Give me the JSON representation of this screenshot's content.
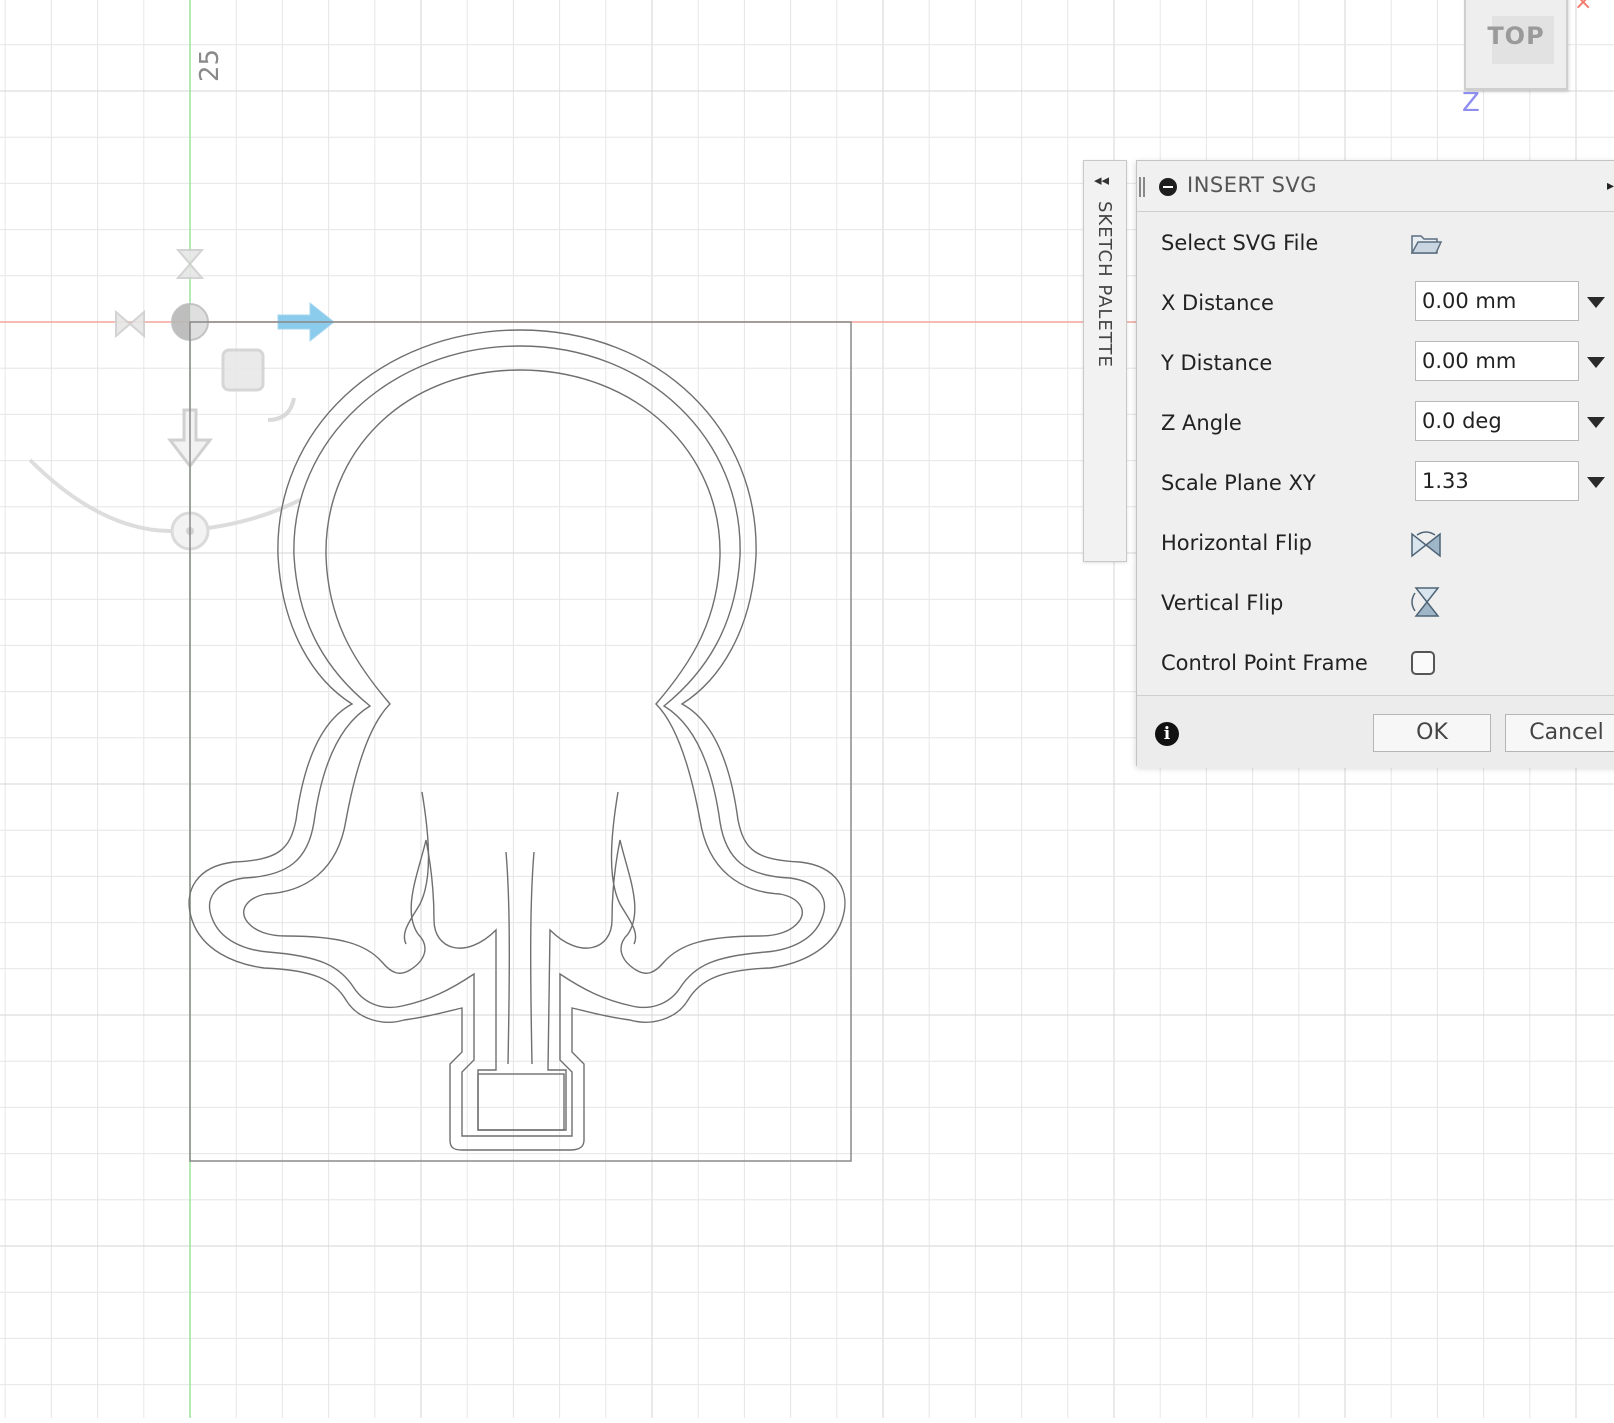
{
  "viewport": {
    "ruler_label": "25",
    "viewcube": {
      "face_label": "TOP",
      "axis_label": "Z",
      "close_symbol": "×"
    }
  },
  "sketch_palette": {
    "label": "SKETCH PALETTE",
    "collapse_symbol": "◂◂"
  },
  "dialog": {
    "title": "INSERT SVG",
    "expand_symbol": "▸",
    "rows": {
      "select_file": {
        "label": "Select SVG File",
        "icon": "folder-open-icon"
      },
      "x_distance": {
        "label": "X Distance",
        "value": "0.00 mm"
      },
      "y_distance": {
        "label": "Y Distance",
        "value": "0.00 mm"
      },
      "z_angle": {
        "label": "Z Angle",
        "value": "0.0 deg"
      },
      "scale": {
        "label": "Scale Plane XY",
        "value": "1.33"
      },
      "horizontal_flip": {
        "label": "Horizontal Flip",
        "icon": "horizontal-flip-icon"
      },
      "vertical_flip": {
        "label": "Vertical Flip",
        "icon": "vertical-flip-icon"
      },
      "control_point_frame": {
        "label": "Control Point Frame",
        "checked": false
      }
    },
    "info_symbol": "i",
    "ok_label": "OK",
    "cancel_label": "Cancel"
  },
  "colors": {
    "grid": "#e6e6e6",
    "grid_major": "#d6d6d6",
    "x_axis": "#f0a59a",
    "y_axis": "#9be39b",
    "sketch_line": "#6a6a6a",
    "manipulator_arrow": "#7fc6ea"
  }
}
